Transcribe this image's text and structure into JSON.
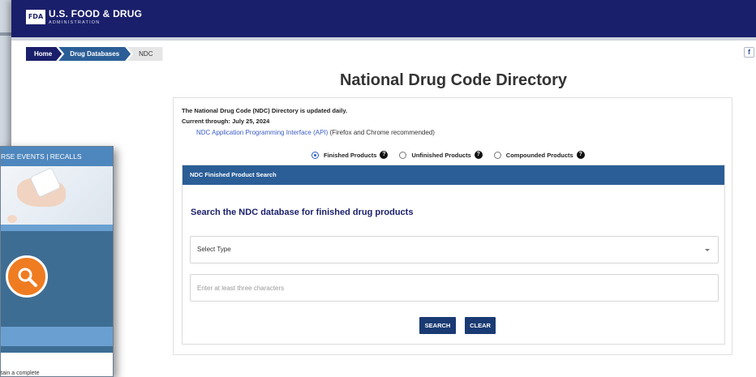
{
  "header": {
    "logo_text": "FDA",
    "agency_name": "U.S. FOOD & DRUG",
    "agency_sub": "ADMINISTRATION"
  },
  "breadcrumb": {
    "home": "Home",
    "drug_databases": "Drug Databases",
    "current": "NDC"
  },
  "social": {
    "facebook_glyph": "f"
  },
  "page": {
    "title": "National Drug Code Directory",
    "update_note": "The National Drug Code (NDC) Directory is updated daily.",
    "current_through": "Current through: July 25, 2024",
    "api_link": "NDC Application Programming Interface (API)",
    "api_note": " (Firefox and Chrome recommended)"
  },
  "product_types": [
    {
      "label": "Finished Products",
      "selected": true
    },
    {
      "label": "Unfinished Products",
      "selected": false
    },
    {
      "label": "Compounded Products",
      "selected": false
    }
  ],
  "search_panel": {
    "header": "NDC Finished Product Search",
    "heading": "Search the NDC database for finished drug products",
    "select_value": "Select Type",
    "input_placeholder": "Enter at least three characters",
    "search_button": "SEARCH",
    "clear_button": "CLEAR"
  },
  "overlay": {
    "nav_text": "RSE EVENTS   |   RECALLS",
    "body_text": "tain a complete"
  },
  "colors": {
    "header_navy": "#1a1f6b",
    "panel_blue": "#2b5e97",
    "button_navy": "#1a3a73",
    "link_blue": "#3a5cc4",
    "overlay_orange": "#ef7c21"
  }
}
